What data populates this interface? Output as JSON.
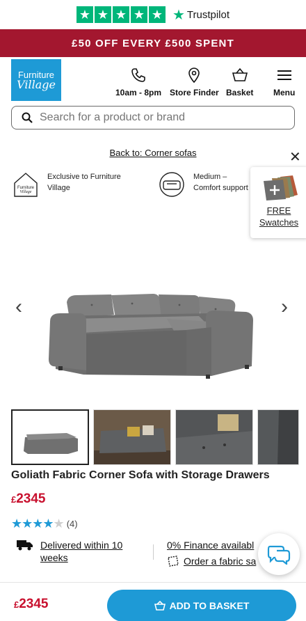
{
  "trustpilot": {
    "brand": "Trustpilot",
    "stars": 5
  },
  "promo": {
    "text": "£50 OFF EVERY £500 SPENT"
  },
  "header": {
    "logo_line1": "Furniture",
    "logo_line2": "Village",
    "phone_label": "10am - 8pm",
    "store_label": "Store Finder",
    "basket_label": "Basket",
    "menu_label": "Menu"
  },
  "search": {
    "placeholder": "Search for a product or brand"
  },
  "breadcrumb": {
    "text": "Back to: Corner sofas"
  },
  "usps": [
    {
      "text": "Exclusive to Furniture Village",
      "icon": "house-logo-icon"
    },
    {
      "text": "Medium – Comfort support",
      "icon": "seat-cushion-icon"
    }
  ],
  "swatches": {
    "line1": "FREE",
    "line2": "Swatches"
  },
  "gallery": {
    "prev_icon": "‹",
    "next_icon": "›",
    "thumbnail_count": 4
  },
  "product": {
    "title": "Goliath Fabric Corner Sofa with Storage Drawers",
    "currency": "£",
    "price": "2345",
    "rating": 4,
    "rating_max": 5,
    "review_count": "(4)"
  },
  "delivery": {
    "text_line1": "Delivered within 10",
    "text_line2": "weeks"
  },
  "finance": {
    "text": "0% Finance availabl",
    "fabric_sample": "Order a fabric sa"
  },
  "bottom_bar": {
    "currency": "£",
    "price": "2345",
    "button_label": "ADD TO BASKET"
  },
  "colors": {
    "brand_blue": "#1e9ad6",
    "promo_red": "#a3172f",
    "price_red": "#c8102e",
    "trustpilot_green": "#00b67a"
  }
}
